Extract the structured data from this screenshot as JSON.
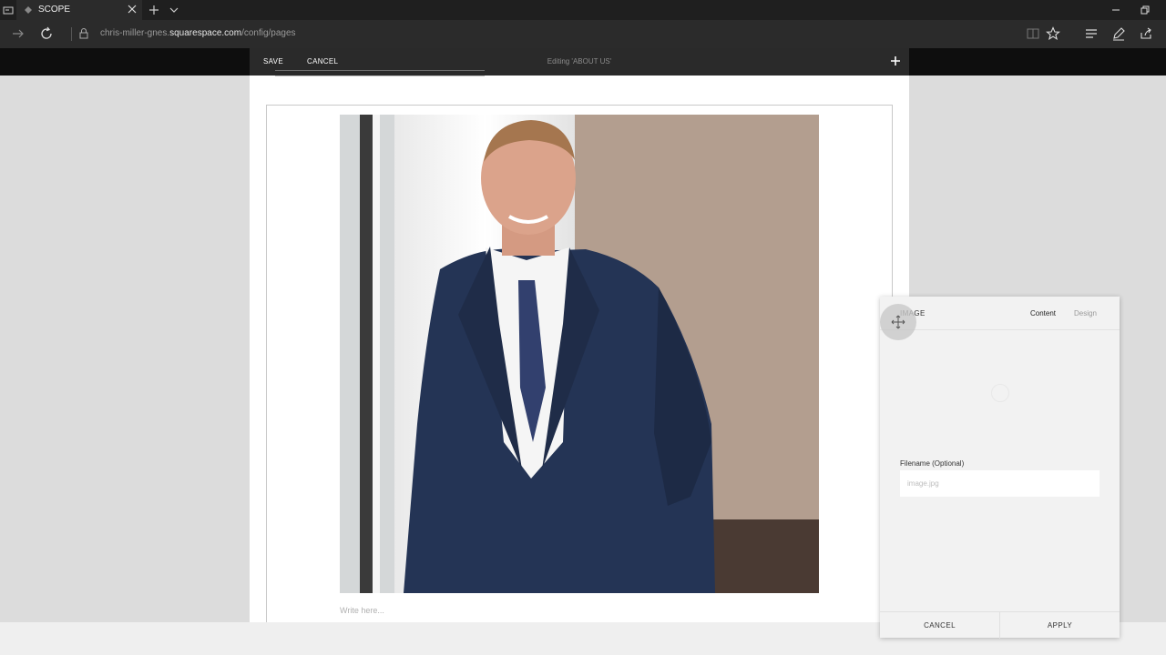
{
  "browser": {
    "tab_title": "SCOPE",
    "url_prefix": "chris-miller-gnes.",
    "url_host": "squarespace.com",
    "url_path": "/config/pages"
  },
  "editor": {
    "save_label": "SAVE",
    "cancel_label": "CANCEL",
    "status": "Editing 'ABOUT US'"
  },
  "page": {
    "write_placeholder": "Write here..."
  },
  "dialog": {
    "title": "IMAGE",
    "tab_content": "Content",
    "tab_design": "Design",
    "filename_label": "Filename (Optional)",
    "filename_placeholder": "image.jpg",
    "cancel_label": "CANCEL",
    "apply_label": "APPLY"
  },
  "colors": {
    "chrome_dark": "#1f1f1f",
    "chrome": "#2b2b2b",
    "editor_bar": "#2a2a2a",
    "backdrop": "#dcdcdc",
    "dialog_bg": "#f2f2f2"
  }
}
